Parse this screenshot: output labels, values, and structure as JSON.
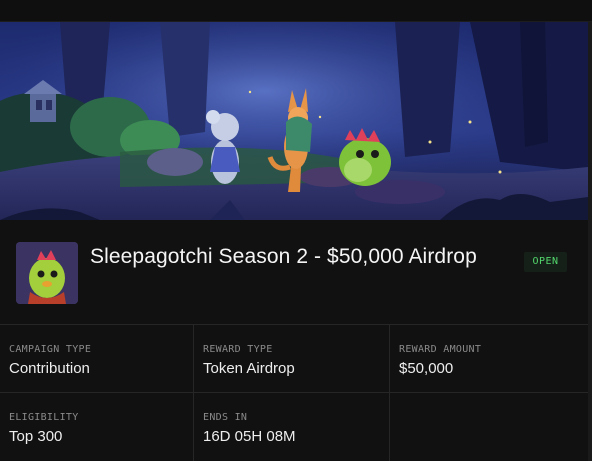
{
  "campaign": {
    "title": "Sleepagotchi Season 2 - $50,000 Airdrop",
    "status": "OPEN",
    "status_color": "#53d66b"
  },
  "details": [
    {
      "label": "CAMPAIGN TYPE",
      "value": "Contribution"
    },
    {
      "label": "REWARD TYPE",
      "value": "Token Airdrop"
    },
    {
      "label": "REWARD AMOUNT",
      "value": "$50,000"
    },
    {
      "label": "ELIGIBILITY",
      "value": "Top 300"
    },
    {
      "label": "ENDS IN",
      "value": "16D 05H 08M"
    }
  ],
  "icons": {
    "banner": "forest-night-characters-image",
    "avatar": "green-creature-avatar"
  }
}
